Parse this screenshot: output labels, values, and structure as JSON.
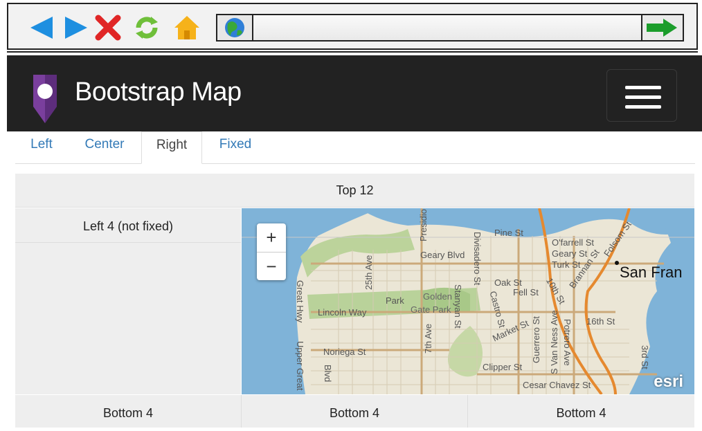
{
  "browser": {
    "icons": [
      "back-arrow-icon",
      "forward-arrow-icon",
      "stop-x-icon",
      "refresh-icon",
      "home-icon",
      "globe-icon",
      "go-arrow-icon"
    ],
    "url_value": ""
  },
  "navbar": {
    "brand": "Bootstrap Map",
    "brand_color": "#7a3f9d"
  },
  "tabs": [
    {
      "label": "Left"
    },
    {
      "label": "Center"
    },
    {
      "label": "Right",
      "active": true
    },
    {
      "label": "Fixed"
    }
  ],
  "layout": {
    "top": "Top 12",
    "left": "Left 4 (not fixed)",
    "bottom": [
      "Bottom 4",
      "Bottom 4",
      "Bottom 4"
    ]
  },
  "map": {
    "zoom_in": "+",
    "zoom_out": "−",
    "city": "San Fran",
    "attribution": "esri",
    "streets": [
      "Pine St",
      "O'farrell St",
      "Geary St",
      "Turk St",
      "Geary Blvd",
      "Divisadero St",
      "Oak St",
      "Fell St",
      "Presidio Blvd",
      "25th Ave",
      "Lincoln Way",
      "Park",
      "Golden",
      "Gate Park",
      "Stanyan St",
      "Great Hwy",
      "Upper Great",
      "Noriega St",
      "Blvd",
      "7th Ave",
      "Castro St",
      "Market St",
      "Guerrero St",
      "S Van Ness Ave",
      "Potrero Ave",
      "16th St",
      "Clipper St",
      "Cesar Chavez St",
      "Folsom St",
      "Brannan St",
      "10th St",
      "3rd St"
    ]
  }
}
